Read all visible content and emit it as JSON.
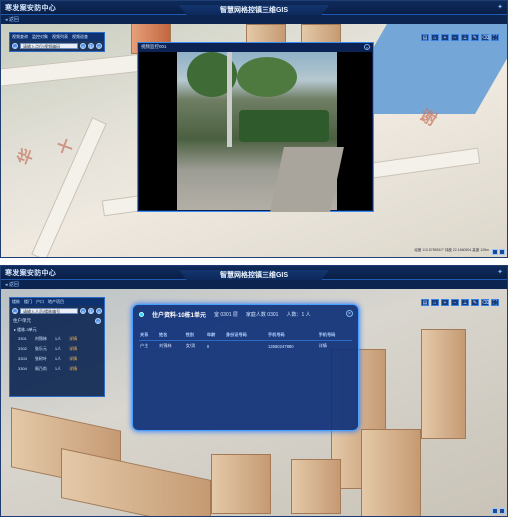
{
  "shot1": {
    "app_name": "寒发案安防中心",
    "title": "智慧网格控镇三维GIS",
    "back_label": "返回",
    "toolbar_tabs": [
      "视频查询",
      "监控对象",
      "视频列表",
      "视频巡查"
    ],
    "search_placeholder": "请输入点位/视频编码",
    "video_dialog_title": "视频监控001",
    "map_labels": [
      "十",
      "华",
      "谢"
    ],
    "coordinates": "经度 113.5755510° 纬度 22.1660504 高度 125m",
    "tool_icons": [
      "layers-icon",
      "home-icon",
      "zoom-in-icon",
      "zoom-out-icon",
      "measure-icon",
      "pen-icon",
      "clear-icon",
      "fullscreen-icon"
    ]
  },
  "shot2": {
    "app_name": "寒发案安防中心",
    "title": "智慧网格控镇三维GIS",
    "back_label": "返回",
    "toolbar_tabs": [
      "楼栋",
      "楼门",
      "户口",
      "地产项目"
    ],
    "search_placeholder": "请输入人员/楼栋编号",
    "list_title": "住户单元",
    "list_unit": "楼栋-3单元",
    "list_rows": [
      {
        "room": "3301",
        "name": "刘锦林",
        "count": "1人",
        "action": "详情"
      },
      {
        "room": "3302",
        "name": "张乐元",
        "count": "1人",
        "action": "详情"
      },
      {
        "room": "3303",
        "name": "张树叶",
        "count": "1人",
        "action": "详情"
      },
      {
        "room": "3304",
        "name": "周乃尚",
        "count": "1人",
        "action": "详情"
      }
    ],
    "info_title": "住户资料-10栋1单元",
    "info_room": "室 0301 层",
    "info_household": "家庭人数 0301",
    "info_count": "人数：1 人",
    "table_headers": [
      "关系",
      "姓名",
      "性别",
      "年龄",
      "身份证号码",
      "手机号码",
      "手机号码"
    ],
    "table_rows": [
      {
        "rel": "户主",
        "name": "刘锦林",
        "gender": "女/男",
        "age": "0",
        "id": "",
        "phone": "13560247880",
        "action": "详情"
      }
    ]
  }
}
